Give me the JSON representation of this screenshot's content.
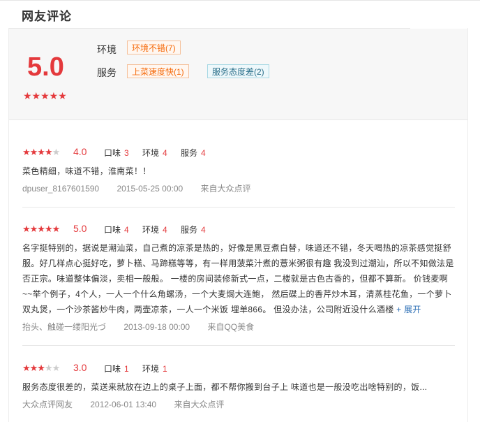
{
  "section_title": "网友评论",
  "summary": {
    "score": "5.0",
    "stars": "★★★★★",
    "rows": [
      {
        "label": "环境",
        "tags": [
          {
            "text": "环境不错(7)",
            "type": "pos"
          }
        ]
      },
      {
        "label": "服务",
        "tags": [
          {
            "text": "上菜速度快(1)",
            "type": "pos"
          },
          {
            "text": "服务态度差(2)",
            "type": "neg"
          }
        ]
      }
    ]
  },
  "reviews": [
    {
      "stars_on": "★★★★",
      "stars_off": "★",
      "star_count": 4,
      "score": "4.0",
      "subs": [
        {
          "label": "口味",
          "value": "3"
        },
        {
          "label": "环境",
          "value": "4"
        },
        {
          "label": "服务",
          "value": "4"
        }
      ],
      "content": "菜色精细，味道不错，淮南菜！！",
      "more": "",
      "user": "dpuser_8167601590",
      "date": "2015-05-25 00:00",
      "source": "来自大众点评"
    },
    {
      "stars_on": "★★★★★",
      "stars_off": "",
      "star_count": 5,
      "score": "5.0",
      "subs": [
        {
          "label": "口味",
          "value": "4"
        },
        {
          "label": "环境",
          "value": "4"
        },
        {
          "label": "服务",
          "value": "4"
        }
      ],
      "content": "名字挺特别的，据说是潮汕菜，自己煮的凉茶是热的，好像是黑豆煮白替，味道还不错，冬天喝热的凉茶感觉挺舒服。好几样点心挺好吃，萝卜糕、马蹄糕等等，有一样用菠菜汁煮的薏米粥很有趣 我没到过潮汕，所以不知做法是否正宗。味道整体偏淡，卖相一般般。 一楼的房间装修新式一点，二楼就是古色古香的，但都不算新。 价钱麦啊~~举个例子，4个人，一人一个什么角螺汤，一个大麦焗大连鲍， 然后碟上的香芹炒木耳，清蒸桂花鱼，一个萝卜双丸煲，一个沙茶酱炒牛肉，两壶凉茶，一人一个米饭 埋单866。 但没办法，公司附近没什么酒楼",
      "more": "+ 展开",
      "user": "抬头、触碰一缕阳光づ",
      "date": "2013-09-18 00:00",
      "source": "来自QQ美食"
    },
    {
      "stars_on": "★★★",
      "stars_off": "★★",
      "star_count": 3,
      "score": "3.0",
      "subs": [
        {
          "label": "口味",
          "value": "1"
        },
        {
          "label": "环境",
          "value": "1"
        }
      ],
      "content": "服务态度很差的，菜送来就放在边上的桌子上面，都不帮你搬到台子上 味道也是一般没吃出啥特别的，饭...",
      "more": "",
      "user": "大众点评网友",
      "date": "2012-06-01 13:40",
      "source": "来自大众点评"
    }
  ]
}
